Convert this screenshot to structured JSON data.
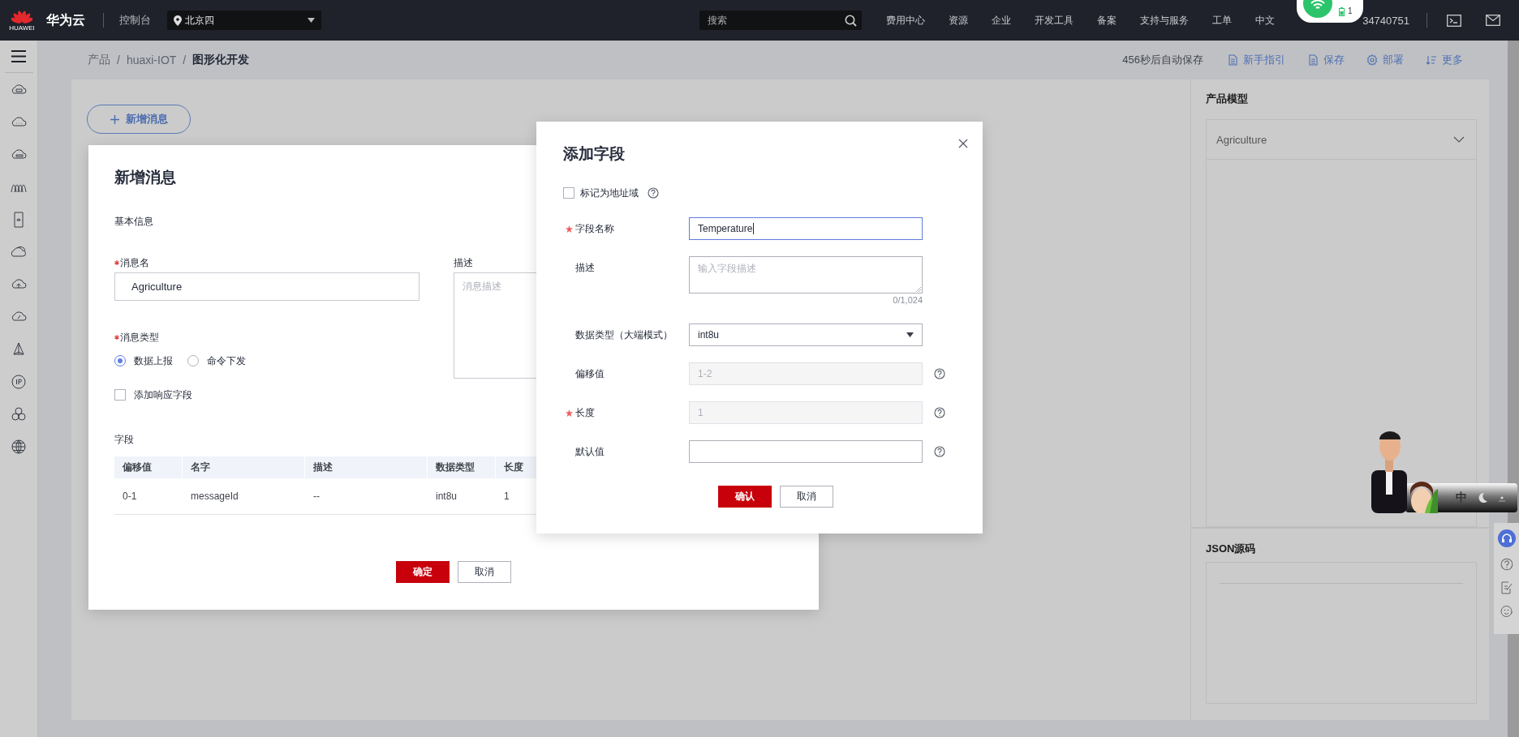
{
  "topbar": {
    "brand_text": "HUAWEI",
    "title": "华为云",
    "console": "控制台",
    "region": "北京四",
    "search": {
      "placeholder": "搜索"
    },
    "nav": [
      "费用中心",
      "资源",
      "企业",
      "开发工具",
      "备案",
      "支持与服务",
      "工单",
      "中文"
    ],
    "account": "34740751"
  },
  "status_widget": {
    "count": "1"
  },
  "breadcrumb": [
    {
      "kind": "link",
      "label": "产品"
    },
    {
      "kind": "separator",
      "label": "/"
    },
    {
      "kind": "link",
      "label": "huaxi-IOT"
    },
    {
      "kind": "separator",
      "label": "/"
    },
    {
      "kind": "current",
      "label": "图形化开发"
    }
  ],
  "toolbar": {
    "autosave": "456秒后自动保存",
    "actions": [
      "新手指引",
      "保存",
      "部署",
      "更多"
    ]
  },
  "add_message_button": "新增消息",
  "product_model": {
    "title": "产品模型",
    "selected": "Agriculture"
  },
  "json_source": {
    "title": "JSON源码"
  },
  "message_dialog": {
    "title": "新增消息",
    "section": "基本信息",
    "name_field": {
      "label": "消息名",
      "required": true,
      "value": "Agriculture"
    },
    "description_field": {
      "label": "描述",
      "placeholder": "消息描述"
    },
    "type_field": {
      "label": "消息类型",
      "required": true,
      "options": [
        {
          "label": "数据上报",
          "selected": true
        },
        {
          "label": "命令下发",
          "selected": false
        }
      ]
    },
    "response_checkbox": {
      "label": "添加响应字段",
      "checked": false
    },
    "fields_title": "字段",
    "table": {
      "columns": [
        "偏移值",
        "名字",
        "描述",
        "数据类型",
        "长度"
      ],
      "rows": [
        [
          "0-1",
          "messageId",
          "--",
          "int8u",
          "1"
        ]
      ]
    },
    "buttons": [
      {
        "label": "确定",
        "kind": "primary"
      },
      {
        "label": "取消",
        "kind": "secondary"
      }
    ]
  },
  "field_dialog": {
    "title": "添加字段",
    "address_checkbox": {
      "label": "标记为地址域",
      "checked": false
    },
    "fields": [
      {
        "kind": "text",
        "label": "字段名称",
        "required": true,
        "value": "Temperature",
        "focused": true,
        "disabled": false,
        "help": false
      },
      {
        "kind": "textarea",
        "label": "描述",
        "required": false,
        "placeholder": "输入字段描述",
        "counter": "0/1,024"
      },
      {
        "kind": "select",
        "label": "数据类型（大端模式）",
        "required": false,
        "value": "int8u"
      },
      {
        "kind": "text",
        "label": "偏移值",
        "required": false,
        "value": "1-2",
        "focused": false,
        "disabled": true,
        "help": true
      },
      {
        "kind": "text",
        "label": "长度",
        "required": true,
        "value": "1",
        "focused": false,
        "disabled": true,
        "help": true
      },
      {
        "kind": "text",
        "label": "默认值",
        "required": false,
        "focused": false,
        "disabled": false,
        "help": true
      }
    ],
    "buttons": [
      {
        "label": "确认",
        "kind": "primary"
      },
      {
        "label": "取消",
        "kind": "secondary"
      }
    ]
  },
  "ime_bar": {
    "mode": "中"
  }
}
